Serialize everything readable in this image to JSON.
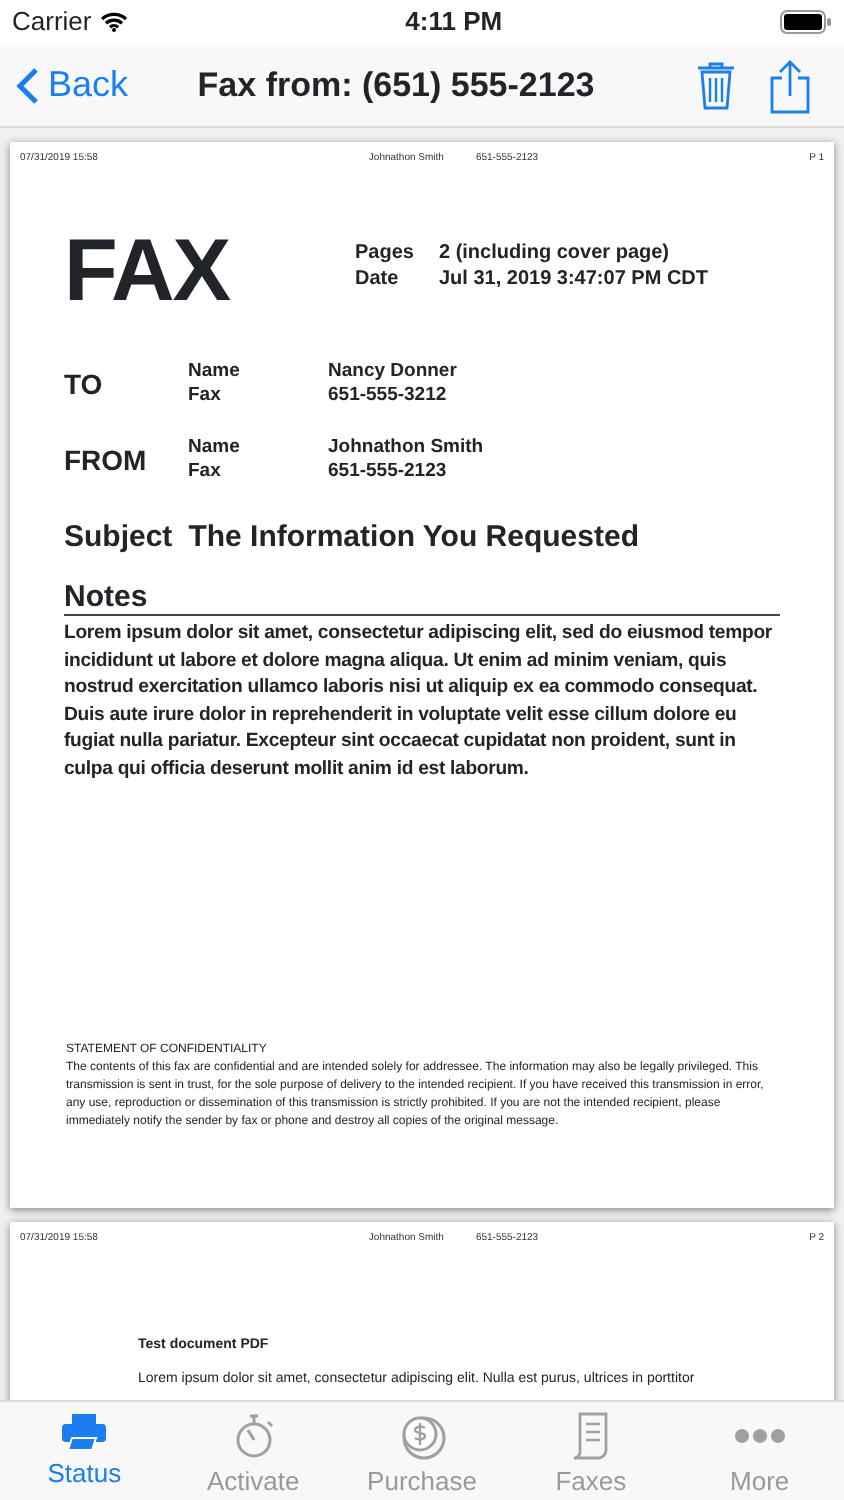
{
  "status_bar": {
    "carrier": "Carrier",
    "time": "4:11 PM"
  },
  "nav": {
    "back": "Back",
    "title": "Fax from: (651) 555-2123"
  },
  "pages": [
    {
      "header": {
        "date": "07/31/2019 15:58",
        "sender": "Johnathon Smith",
        "number": "651-555-2123",
        "page": "P 1"
      },
      "kind": "cover",
      "heading": "FAX",
      "meta": [
        {
          "label": "Pages",
          "value": "2 (including cover page)"
        },
        {
          "label": "Date",
          "value": "Jul 31, 2019 3:47:07 PM CDT"
        }
      ],
      "parties": [
        {
          "role": "TO",
          "fields": [
            {
              "label": "Name",
              "value": "Nancy Donner"
            },
            {
              "label": "Fax",
              "value": "651-555-3212"
            }
          ]
        },
        {
          "role": "FROM",
          "fields": [
            {
              "label": "Name",
              "value": "Johnathon Smith"
            },
            {
              "label": "Fax",
              "value": "651-555-2123"
            }
          ]
        }
      ],
      "subject_label": "Subject",
      "subject": "The Information You Requested",
      "notes_label": "Notes",
      "notes": "Lorem ipsum dolor sit amet, consectetur adipiscing elit, sed do eiusmod tempor incididunt ut labore et dolore magna aliqua. Ut enim ad minim veniam, quis nostrud exercitation ullamco laboris nisi ut aliquip ex ea commodo consequat. Duis aute irure dolor in reprehenderit in voluptate velit esse cillum dolore eu fugiat nulla pariatur. Excepteur sint occaecat cupidatat non proident, sunt in culpa qui officia deserunt mollit anim id est laborum.",
      "confidentiality_title": "STATEMENT OF CONFIDENTIALITY",
      "confidentiality": "The contents of this fax are confidential and are intended solely for addressee. The information may also be legally privileged. This transmission is sent in trust, for the sole purpose of delivery to the intended recipient. If you have received this transmission in error, any use, reproduction or dissemination of this transmission is strictly prohibited. If you are not the intended recipient, please immediately notify the sender by fax or phone and destroy all copies of the original message."
    },
    {
      "header": {
        "date": "07/31/2019 15:58",
        "sender": "Johnathon Smith",
        "number": "651-555-2123",
        "page": "P 2"
      },
      "kind": "document",
      "doc_title": "Test document PDF",
      "body": "Lorem ipsum dolor sit amet, consectetur adipiscing elit. Nulla est purus, ultrices in porttitor"
    }
  ],
  "tabs": [
    {
      "label": "Status",
      "selected": true
    },
    {
      "label": "Activate",
      "selected": false
    },
    {
      "label": "Purchase",
      "selected": false
    },
    {
      "label": "Faxes",
      "selected": false
    },
    {
      "label": "More",
      "selected": false
    }
  ]
}
